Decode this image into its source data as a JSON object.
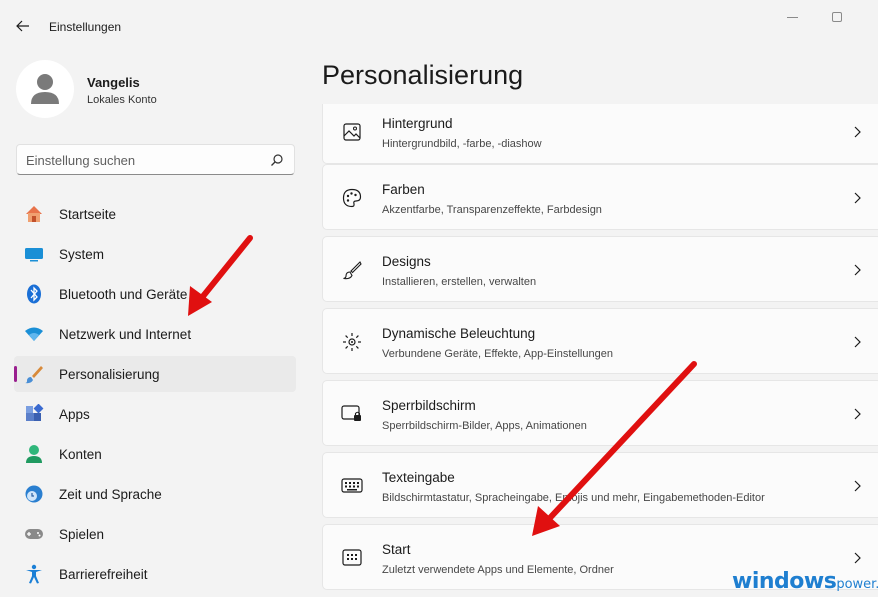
{
  "window": {
    "title": "Einstellungen"
  },
  "user": {
    "name": "Vangelis",
    "account_type": "Lokales Konto"
  },
  "search": {
    "placeholder": "Einstellung suchen"
  },
  "sidebar": {
    "items": [
      {
        "label": "Startseite",
        "icon": "home-icon"
      },
      {
        "label": "System",
        "icon": "system-icon"
      },
      {
        "label": "Bluetooth und Geräte",
        "icon": "bluetooth-icon"
      },
      {
        "label": "Netzwerk und Internet",
        "icon": "wifi-icon"
      },
      {
        "label": "Personalisierung",
        "icon": "paintbrush-icon",
        "active": true
      },
      {
        "label": "Apps",
        "icon": "apps-icon"
      },
      {
        "label": "Konten",
        "icon": "account-icon"
      },
      {
        "label": "Zeit und Sprache",
        "icon": "clock-globe-icon"
      },
      {
        "label": "Spielen",
        "icon": "gamepad-icon"
      },
      {
        "label": "Barrierefreiheit",
        "icon": "accessibility-icon"
      }
    ],
    "accent_color": "#9a1f8f"
  },
  "main": {
    "title": "Personalisierung",
    "cards": [
      {
        "title": "Hintergrund",
        "subtitle": "Hintergrundbild, -farbe, -diashow",
        "icon": "picture-icon"
      },
      {
        "title": "Farben",
        "subtitle": "Akzentfarbe, Transparenzeffekte, Farbdesign",
        "icon": "palette-icon"
      },
      {
        "title": "Designs",
        "subtitle": "Installieren, erstellen, verwalten",
        "icon": "brush-icon"
      },
      {
        "title": "Dynamische Beleuchtung",
        "subtitle": "Verbundene Geräte, Effekte, App-Einstellungen",
        "icon": "lighting-icon"
      },
      {
        "title": "Sperrbildschirm",
        "subtitle": "Sperrbildschirm-Bilder, Apps, Animationen",
        "icon": "lockscreen-icon"
      },
      {
        "title": "Texteingabe",
        "subtitle": "Bildschirmtastatur, Spracheingabe, Emojis und mehr, Eingabemethoden-Editor",
        "icon": "keyboard-icon"
      },
      {
        "title": "Start",
        "subtitle": "Zuletzt verwendete Apps und Elemente, Ordner",
        "icon": "start-icon"
      }
    ]
  },
  "watermark": {
    "brand": "windows",
    "suffix": "power.",
    "color": "#1f7fd0"
  },
  "annotation_color": "#e01010"
}
